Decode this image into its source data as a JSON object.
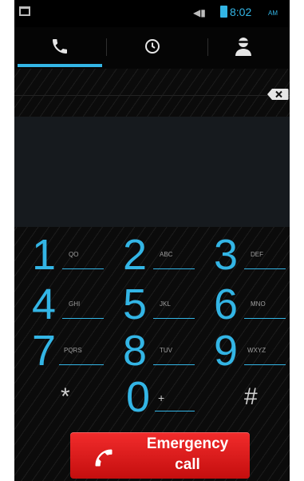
{
  "status_bar": {
    "time": "8:02",
    "ampm": "AM",
    "icons": [
      "notification-icon",
      "volume-icon",
      "battery-icon"
    ]
  },
  "tabs": [
    {
      "name": "phone",
      "icon": "phone-icon",
      "selected": true
    },
    {
      "name": "recent",
      "icon": "clock-icon",
      "selected": false
    },
    {
      "name": "contacts",
      "icon": "contacts-icon",
      "selected": false
    }
  ],
  "number_display": {
    "value": ""
  },
  "delete_icon": "backspace-icon",
  "keypad": {
    "keys": [
      {
        "digit": "1",
        "letters": "QO"
      },
      {
        "digit": "2",
        "letters": "ABC"
      },
      {
        "digit": "3",
        "letters": "DEF"
      },
      {
        "digit": "4",
        "letters": "GHI"
      },
      {
        "digit": "5",
        "letters": "JKL"
      },
      {
        "digit": "6",
        "letters": "MNO"
      },
      {
        "digit": "7",
        "letters": "PQRS"
      },
      {
        "digit": "8",
        "letters": "TUV"
      },
      {
        "digit": "9",
        "letters": "WXYZ"
      },
      {
        "digit": "*",
        "letters": ""
      },
      {
        "digit": "0",
        "letters": "+"
      },
      {
        "digit": "#",
        "letters": ""
      }
    ]
  },
  "emergency": {
    "line1": "Emergency",
    "line2": "call"
  },
  "colors": {
    "accent": "#33b5e5",
    "emergency": "#e11d1d",
    "background": "#0b0b0b"
  }
}
